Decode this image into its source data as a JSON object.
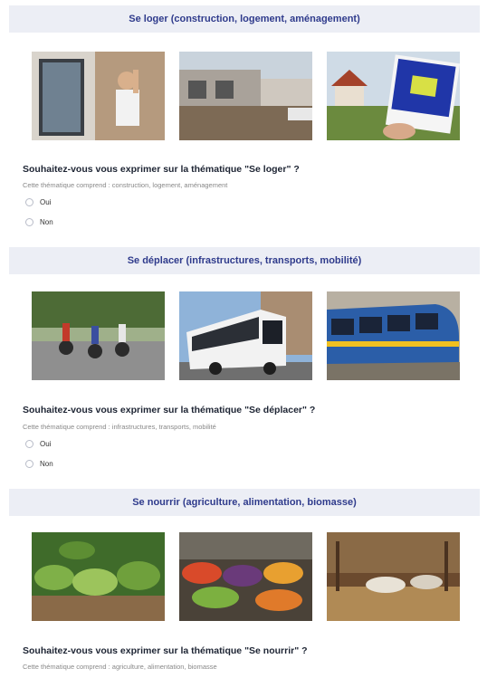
{
  "sections": [
    {
      "title": "Se loger (construction, logement, aménagement)",
      "question": "Souhaitez-vous vous exprimer sur la thématique \"Se loger\" ?",
      "description": "Cette thématique comprend : construction, logement, aménagement",
      "options": [
        "Oui",
        "Non"
      ]
    },
    {
      "title": "Se déplacer (infrastructures, transports, mobilité)",
      "question": "Souhaitez-vous vous exprimer sur la thématique \"Se déplacer\" ?",
      "description": "Cette thématique comprend : infrastructures, transports, mobilité",
      "options": [
        "Oui",
        "Non"
      ]
    },
    {
      "title": "Se nourrir (agriculture, alimentation, biomasse)",
      "question": "Souhaitez-vous vous exprimer sur la thématique \"Se nourrir\" ?",
      "description": "Cette thématique comprend : agriculture, alimentation, biomasse"
    }
  ],
  "colors": {
    "header_bg": "#eceef5",
    "header_text": "#2f3b8c"
  }
}
